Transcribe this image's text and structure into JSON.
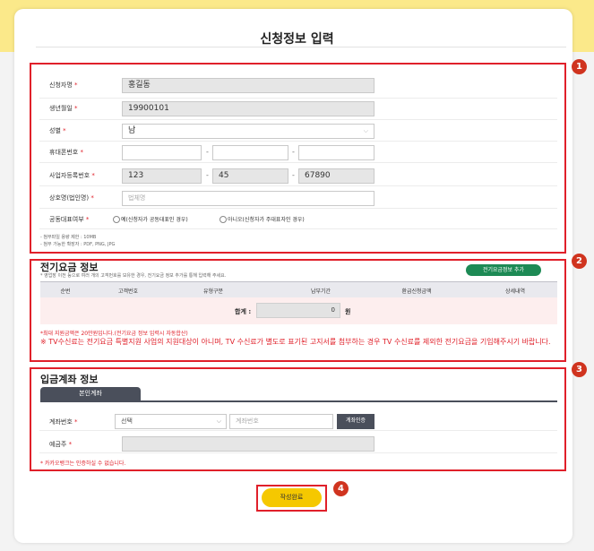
{
  "page_title": "신청정보 입력",
  "sections": {
    "s1": {
      "badge": "1",
      "labels": {
        "name": "신청자명",
        "birth": "생년월일",
        "gender": "성별",
        "phone": "휴대폰번호",
        "bizno": "사업자등록번호",
        "company": "상호명(법인명)",
        "joint": "공동대표여부"
      },
      "required_mark": "*",
      "values": {
        "name": "홍길동",
        "birth": "19900101",
        "gender": "남",
        "biz1": "123",
        "biz2": "45",
        "biz3": "67890"
      },
      "company_placeholder": "법체명",
      "joint_options": [
        "예(신청자가 공동대표인 경우)",
        "아니오(신청자가 주대표자인 경우)"
      ],
      "notes": [
        "- 첨부파일 용량 제한 : 10MB",
        "- 첨부 가능한 확장자 : PDF, PNG, JPG"
      ]
    },
    "s2": {
      "badge": "2",
      "title": "전기요금 정보",
      "subtitle": "* 영업장 이전 등으로 여러 개의 고객번호를 보유한 경우, 전기요금 정보 추가를 통해 입력해 주세요.",
      "add_button": "전기요금정보 추가",
      "columns": [
        "순번",
        "고객번호",
        "유형구분",
        "납부기간",
        "환급신청금액",
        "상세내역"
      ],
      "total_label": "합계 :",
      "total_value": "0",
      "unit": "원",
      "note1": "*최대 지원금액은 20만원입니다.(전기요금 정보 입력시 자동합산)",
      "note2": "※ TV수신료는 전기요금 특별지원 사업의 지원대상이 아니며, TV 수신료가 별도로 표기된 고지서를 첨부하는 경우 TV 수신료를 제외한 전기요금을 기입해주시기 바랍니다."
    },
    "s3": {
      "badge": "3",
      "title": "입금계좌 정보",
      "tab": "본인계좌",
      "labels": {
        "account": "계좌번호",
        "holder": "예금주"
      },
      "bank_select": "선택",
      "account_placeholder": "계좌번호",
      "verify_button": "계좌인증",
      "note": "* 카카오뱅크는 인증하실 수 없습니다."
    },
    "s4": {
      "badge": "4",
      "submit": "작성완료"
    }
  }
}
